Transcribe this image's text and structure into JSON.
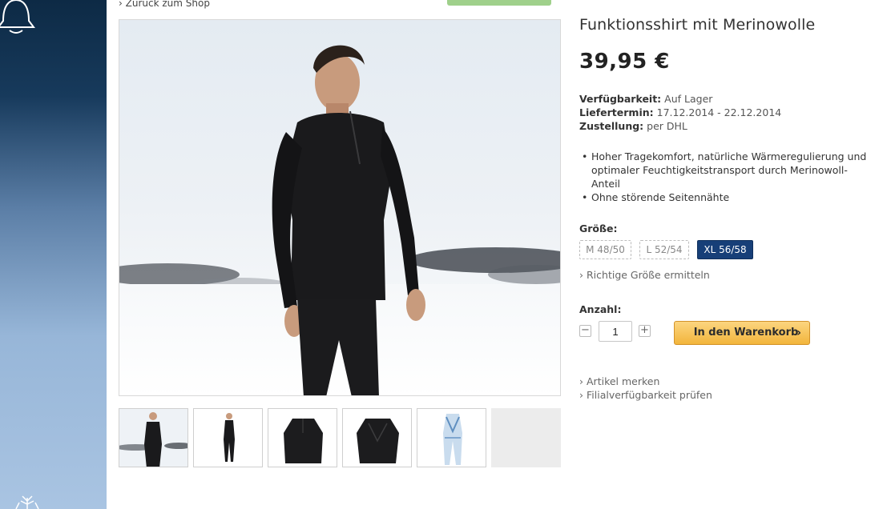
{
  "nav": {
    "back_label": "Zurück zum Shop"
  },
  "product": {
    "title": "Funktionsshirt mit Merinowolle",
    "price": "39,95 €",
    "availability_label": "Verfügbarkeit:",
    "availability_value": "Auf Lager",
    "delivery_label": "Liefertermin:",
    "delivery_value": "17.12.2014 - 22.12.2014",
    "shipping_label": "Zustellung:",
    "shipping_value": "per DHL",
    "features": [
      "Hoher Tragekomfort, natürliche Wärmeregulierung und optimaler Feuchtigkeitstransport durch Merinowoll-Anteil",
      "Ohne störende Seitennähte"
    ]
  },
  "size": {
    "label": "Größe:",
    "options": [
      "M 48/50",
      "L 52/54",
      "XL 56/58"
    ],
    "selected": "XL 56/58",
    "guide_link": "Richtige Größe ermitteln"
  },
  "quantity": {
    "label": "Anzahl:",
    "value": "1",
    "minus": "−",
    "plus": "+"
  },
  "cart": {
    "button_label": "In den Warenkorb",
    "chevron": "›"
  },
  "links": {
    "remember": "Artikel merken",
    "store_availability": "Filialverfügbarkeit prüfen"
  },
  "colors": {
    "accent_blue": "#173f78",
    "cart_orange": "#f2b53c",
    "green_button": "#9fd08b"
  },
  "icons": [
    "bell-icon",
    "chevron-right-icon",
    "minus-icon",
    "plus-icon"
  ]
}
